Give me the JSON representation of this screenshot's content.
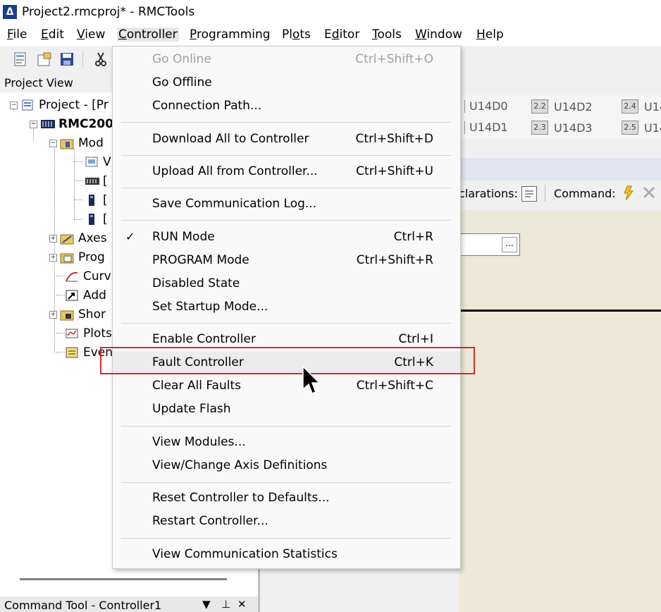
{
  "window": {
    "title": "Project2.rmcproj* - RMCTools",
    "logo_glyph": "Δ"
  },
  "menubar": {
    "items": [
      {
        "label": "File",
        "mnemonic": "F"
      },
      {
        "label": "Edit",
        "mnemonic": "E"
      },
      {
        "label": "View",
        "mnemonic": "V"
      },
      {
        "label": "Controller",
        "mnemonic": "C"
      },
      {
        "label": "Programming",
        "mnemonic": "P"
      },
      {
        "label": "Plots",
        "mnemonic": "o"
      },
      {
        "label": "Editor",
        "mnemonic": "d"
      },
      {
        "label": "Tools",
        "mnemonic": "T"
      },
      {
        "label": "Window",
        "mnemonic": "W"
      },
      {
        "label": "Help",
        "mnemonic": "H"
      }
    ]
  },
  "project_view": {
    "title": "Project View",
    "tree": [
      {
        "label": "Project - [Pr",
        "icon": "project-icon"
      },
      {
        "label": "RMC200",
        "icon": "controller-icon"
      },
      {
        "label": "Mod",
        "icon": "modules-folder-icon"
      },
      {
        "label": "V",
        "icon": "module-icon"
      },
      {
        "label": "[",
        "icon": "module-rack-icon"
      },
      {
        "label": "[",
        "icon": "module-card-icon"
      },
      {
        "label": "[",
        "icon": "module-card-icon"
      },
      {
        "label": "Axes",
        "icon": "axes-icon"
      },
      {
        "label": "Prog",
        "icon": "programs-icon"
      },
      {
        "label": "Curv",
        "icon": "curves-icon"
      },
      {
        "label": "Add",
        "icon": "add-icon"
      },
      {
        "label": "Shor",
        "icon": "shortcuts-icon"
      },
      {
        "label": "Plots",
        "icon": "plots-icon"
      },
      {
        "label": "Even",
        "icon": "events-icon"
      }
    ]
  },
  "io_panel": {
    "cells": [
      {
        "box": "",
        "label": "U14D0"
      },
      {
        "box": "2.2",
        "label": "U14D2"
      },
      {
        "box": "2.4",
        "label": "U14"
      },
      {
        "box": "",
        "label": "U14D1"
      },
      {
        "box": "2.3",
        "label": "U14D3"
      },
      {
        "box": "2.5",
        "label": "U14"
      }
    ]
  },
  "editor_toolbar": {
    "declarations_label": "clarations:",
    "command_label": "Command:"
  },
  "editor": {
    "ellipsis": "..."
  },
  "command_tool": {
    "title": "Command Tool - Controller1",
    "dropdown_glyph": "▼",
    "pin_glyph": "⊥",
    "close_glyph": "✕"
  },
  "controller_menu": {
    "items": [
      {
        "label": "Go Online",
        "shortcut": "Ctrl+Shift+O",
        "disabled": true
      },
      {
        "label": "Go Offline",
        "shortcut": ""
      },
      {
        "label": "Connection Path...",
        "shortcut": ""
      },
      {
        "label": "Download All to Controller",
        "shortcut": "Ctrl+Shift+D"
      },
      {
        "label": "Upload All from Controller...",
        "shortcut": "Ctrl+Shift+U"
      },
      {
        "label": "Save Communication Log...",
        "shortcut": ""
      },
      {
        "label": "RUN Mode",
        "shortcut": "Ctrl+R",
        "checked": true
      },
      {
        "label": "PROGRAM Mode",
        "shortcut": "Ctrl+Shift+R"
      },
      {
        "label": "Disabled State",
        "shortcut": ""
      },
      {
        "label": "Set Startup Mode...",
        "shortcut": ""
      },
      {
        "label": "Enable Controller",
        "shortcut": "Ctrl+I"
      },
      {
        "label": "Fault Controller",
        "shortcut": "Ctrl+K",
        "hover": true
      },
      {
        "label": "Clear All Faults",
        "shortcut": "Ctrl+Shift+C"
      },
      {
        "label": "Update Flash",
        "shortcut": ""
      },
      {
        "label": "View Modules...",
        "shortcut": ""
      },
      {
        "label": "View/Change Axis Definitions",
        "shortcut": ""
      },
      {
        "label": "Reset Controller to Defaults...",
        "shortcut": ""
      },
      {
        "label": "Restart Controller...",
        "shortcut": ""
      },
      {
        "label": "View Communication Statistics",
        "shortcut": ""
      }
    ],
    "check_glyph": "✓"
  },
  "colors": {
    "highlight_border": "#d42b2b",
    "menu_bg": "#f9f9f9",
    "disabled_text": "#a0a0a0"
  }
}
